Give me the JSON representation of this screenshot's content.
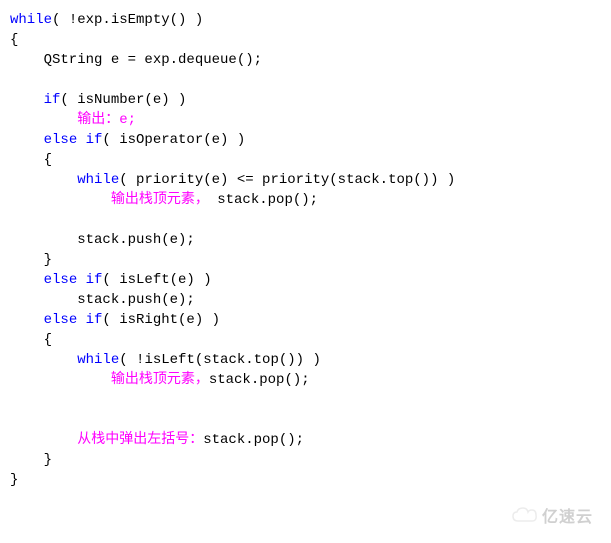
{
  "code": {
    "l1_kw": "while",
    "l1_rest": "( !exp.isEmpty() )",
    "l2": "{",
    "l3": "    QString e = exp.dequeue();",
    "l4": "",
    "l5_pad": "    ",
    "l5_kw": "if",
    "l5_rest": "( isNumber(e) )",
    "l6_pad": "        ",
    "l6_pink": "输出：e;",
    "l7_pad": "    ",
    "l7_kw": "else if",
    "l7_rest": "( isOperator(e) )",
    "l8": "    {",
    "l9_pad": "        ",
    "l9_kw": "while",
    "l9_rest": "( priority(e) <= priority(stack.top()) )",
    "l10_pad": "            ",
    "l10_pink": "输出栈顶元素，",
    "l10_rest": " stack.pop();",
    "l11": "",
    "l12": "        stack.push(e);",
    "l13": "    }",
    "l14_pad": "    ",
    "l14_kw": "else if",
    "l14_rest": "( isLeft(e) )",
    "l15": "        stack.push(e);",
    "l16_pad": "    ",
    "l16_kw": "else if",
    "l16_rest": "( isRight(e) )",
    "l17": "    {",
    "l18_pad": "        ",
    "l18_kw": "while",
    "l18_rest": "( !isLeft(stack.top()) )",
    "l19_pad": "            ",
    "l19_pink": "输出栈顶元素，",
    "l19_rest": "stack.pop();",
    "l20": "",
    "l21": "",
    "l22_pad": "        ",
    "l22_pink": "从栈中弹出左括号：",
    "l22_rest": "stack.pop();",
    "l23": "    }",
    "l24": "}"
  },
  "watermark": "亿速云"
}
